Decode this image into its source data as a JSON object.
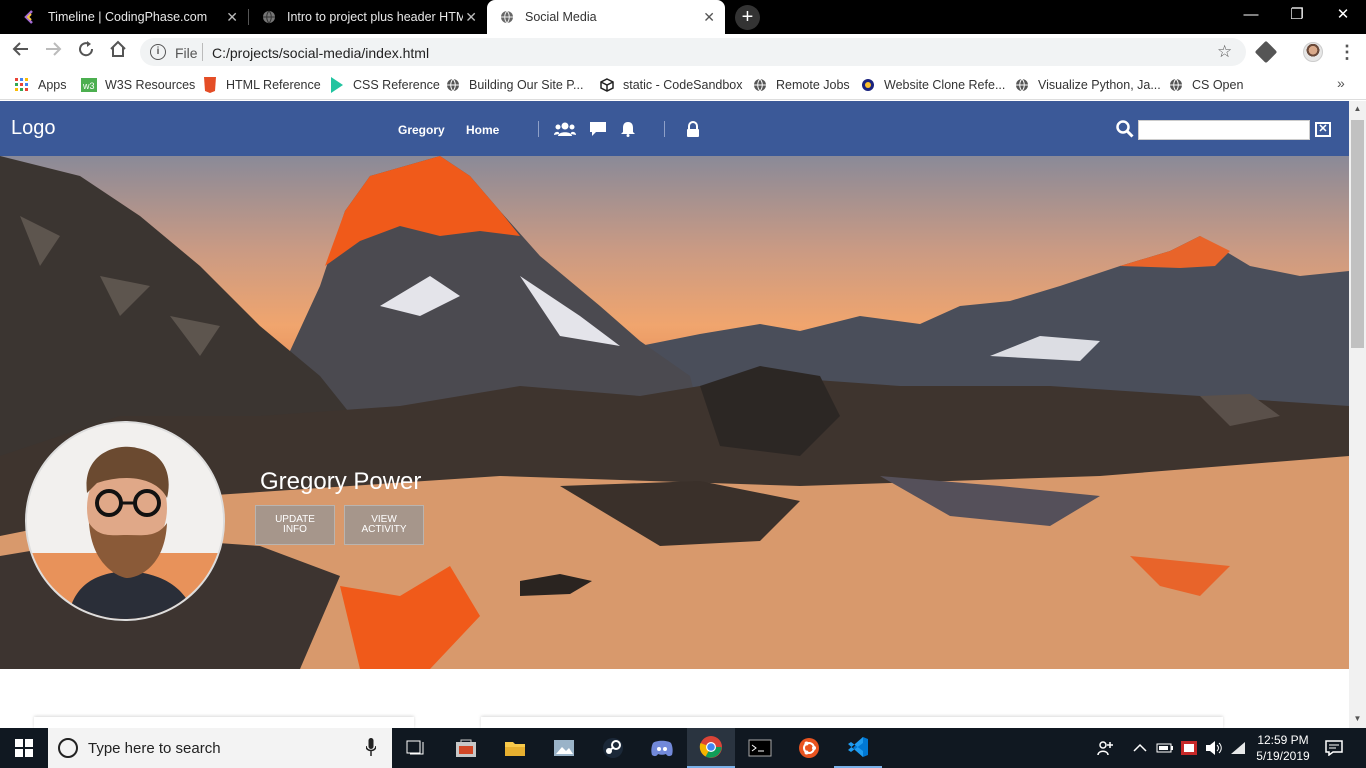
{
  "browser": {
    "tabs": [
      {
        "title": "Timeline | CodingPhase.com",
        "active": false
      },
      {
        "title": "Intro to project plus header HTML",
        "active": false
      },
      {
        "title": "Social Media",
        "active": true
      }
    ],
    "new_tab": "+",
    "window_controls": {
      "minimize": "—",
      "restore": "❐",
      "close": "✕"
    },
    "close_glyph": "✕",
    "address": {
      "scheme": "File",
      "url": "C:/projects/social-media/index.html"
    },
    "bookmarks": [
      {
        "label": "Apps",
        "icon": "apps-grid-icon"
      },
      {
        "label": "W3S Resources",
        "icon": "w3s-icon"
      },
      {
        "label": "HTML Reference",
        "icon": "html5-icon"
      },
      {
        "label": "CSS Reference",
        "icon": "css-icon"
      },
      {
        "label": "Building Our Site P...",
        "icon": "globe-icon"
      },
      {
        "label": "static - CodeSandbox",
        "icon": "codesandbox-icon"
      },
      {
        "label": "Remote Jobs",
        "icon": "globe-icon"
      },
      {
        "label": "Website Clone Refe...",
        "icon": "circle-icon"
      },
      {
        "label": "Visualize Python, Ja...",
        "icon": "globe-icon"
      },
      {
        "label": "CS Open",
        "icon": "globe-icon"
      }
    ],
    "bookmarks_more": "»"
  },
  "site": {
    "logo": "Logo",
    "nav": [
      "Gregory",
      "Home"
    ],
    "header_icons": [
      "friends-icon",
      "chat-icon",
      "bell-icon",
      "lock-icon"
    ],
    "search": {
      "placeholder": "",
      "value": "",
      "clear": "✕"
    },
    "colors": {
      "header": "#3b5998"
    }
  },
  "profile": {
    "name": "Gregory Power",
    "buttons": [
      "UPDATE INFO",
      "VIEW ACTIVITY"
    ]
  },
  "taskbar": {
    "search_placeholder": "Type here to search",
    "apps": [
      "task-view-icon",
      "store-icon",
      "file-explorer-icon",
      "photos-icon",
      "steam-icon",
      "discord-icon",
      "chrome-icon",
      "terminal-icon",
      "ubuntu-icon",
      "vscode-icon"
    ],
    "time": "12:59 PM",
    "date": "5/19/2019"
  }
}
